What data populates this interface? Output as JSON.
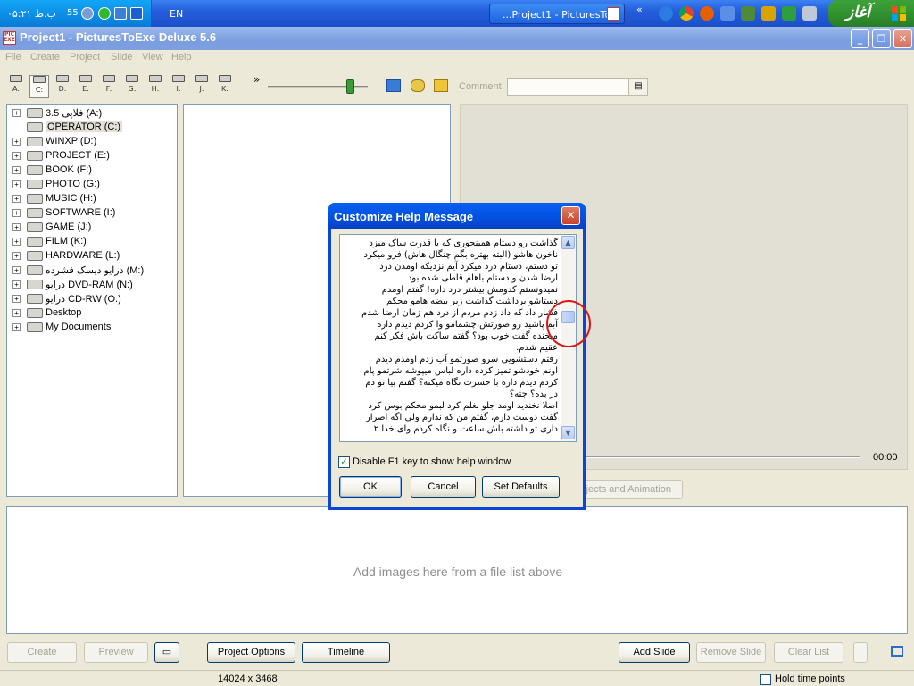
{
  "taskbar": {
    "clock": "۰۵:۲۱ ب.ظ",
    "tray_number": "55",
    "language": "EN",
    "task_button_label": "...Project1 - PicturesTo",
    "quicklaunch_chevron": "«",
    "start_label": "آغاز",
    "tray_icons": [
      "ie-icon",
      "green-circle-icon",
      "text-icon",
      "flash-icon"
    ],
    "quicklaunch_icons": [
      "ie-icon",
      "chrome-icon",
      "firefox-icon",
      "text-icon",
      "network-icon",
      "paint-icon",
      "tree-icon",
      "settings-icon"
    ]
  },
  "window": {
    "title": "Project1 - PicturesToExe Deluxe 5.6",
    "app_icon_text": "PIC EXE",
    "controls": [
      "_",
      "❐",
      "✕"
    ]
  },
  "menu": [
    "File",
    "Create",
    "Project",
    "Slide",
    "View",
    "Help"
  ],
  "toolbar": {
    "drives": [
      "A:",
      "C:",
      "D:",
      "E:",
      "F:",
      "G:",
      "H:",
      "I:",
      "J:",
      "K:"
    ],
    "selected_drive": "C:",
    "more": "»",
    "zoom_level": 0.85,
    "comment_label": "Comment",
    "comment_value": ""
  },
  "tree": [
    {
      "label": "فلاپی 3.5 (A:)",
      "expandable": true
    },
    {
      "label": "OPERATOR (C:)",
      "expandable": false,
      "selected": true
    },
    {
      "label": "WINXP (D:)",
      "expandable": true
    },
    {
      "label": "PROJECT (E:)",
      "expandable": true
    },
    {
      "label": "BOOK (F:)",
      "expandable": true
    },
    {
      "label": "PHOTO (G:)",
      "expandable": true
    },
    {
      "label": "MUSIC (H:)",
      "expandable": true
    },
    {
      "label": "SOFTWARE (I:)",
      "expandable": true
    },
    {
      "label": "GAME (J:)",
      "expandable": true
    },
    {
      "label": "FILM (K:)",
      "expandable": true
    },
    {
      "label": "HARDWARE (L:)",
      "expandable": true
    },
    {
      "label": "درايو ديسک فشرده (M:)",
      "expandable": true
    },
    {
      "label": "درايو DVD-RAM (N:)",
      "expandable": true
    },
    {
      "label": "درايو CD-RW (O:)",
      "expandable": true
    },
    {
      "label": "Desktop",
      "expandable": true
    },
    {
      "label": "My Documents",
      "expandable": true
    }
  ],
  "preview": {
    "time": "00:00",
    "objects_button": "Objects and Animation"
  },
  "slidelist": {
    "hint": "Add images here from a file list above"
  },
  "bottom_buttons": {
    "create": "Create",
    "preview": "Preview",
    "project_options": "Project Options",
    "timeline": "Timeline",
    "add_slide": "Add Slide",
    "remove_slide": "Remove Slide",
    "clear_list": "Clear List"
  },
  "status": {
    "dimensions": "14024 x 3468",
    "hold_time_points": "Hold time points"
  },
  "dialog": {
    "title": "Customize Help Message",
    "message_lines": [
      "گذاشت رو دستام همینجوری که با قدرت ساک میزد",
      "ناخون هاشو (البته بهتره بگم چنگال هاش) فرو میکرد",
      "تو دستم، دستام درد میکرد آیم نزدیکه اومدن درد",
      "ارضا شدن و دستام باهام قاطی شده بود",
      "نمیدونستم کدومش بیشتر درد داره! گفتم اومدم",
      "دستاشو برداشت گذاشت زیر بیضه هامو محکم",
      "فشار داد که داد زدم مردم از درد هم زمان ارضا شدم",
      "آبم پاشید رو صورتش،چشمامو وا کردم دیدم داره",
      "میخنده گفت خوب بود؟ گفتم ساکت باش فکر کنم",
      "عقیم شدم.",
      "رفتم دستشویی سرو صورتمو آب زدم اومدم دیدم",
      "اونم خودشو تمیز کرده داره لباس میپوشه شرتمو پام",
      "کردم دیدم داره با حسرت نگاه میکنه؟ گفتم بیا تو دم",
      "در بده؟ چته؟",
      "اصلا نخندید اومد جلو بغلم کرد لبمو محکم بوس کرد",
      "گفت دوست دارم، گفتم من که ندارم ولی اگه اصرار",
      "داری تو داشته باش.ساعت و نگاه کردم وای خدا ۲"
    ],
    "checkbox_label": "Disable F1 key to show help window",
    "checkbox_checked": true,
    "ok": "OK",
    "cancel": "Cancel",
    "set_defaults": "Set Defaults",
    "close": "✕"
  },
  "colors": {
    "taskbar_blue": "#245EDC",
    "dialog_title_blue": "#0253E3",
    "start_green": "#2F8F2D",
    "annotation_red": "#E01212"
  }
}
